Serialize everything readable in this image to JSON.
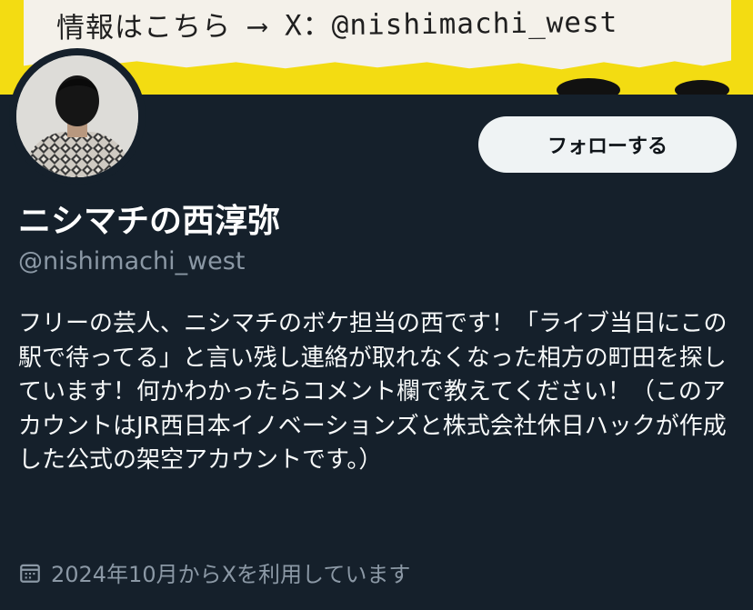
{
  "banner": {
    "text": "情報はこちら ⟶ X：@nishimachi_west"
  },
  "profile": {
    "follow_label": "フォローする",
    "display_name": "ニシマチの西淳弥",
    "handle": "@nishimachi_west",
    "bio": "フリーの芸人、ニシマチのボケ担当の西です！「ライブ当日にこの駅で待ってる」と言い残し連絡が取れなくなった相方の町田を探しています！何かわかったらコメント欄で教えてください！（このアカウントはJR西日本イノベーションズと株式会社休日ハックが作成した公式の架空アカウントです。）",
    "joined": "2024年10月からXを利用しています"
  },
  "icons": {
    "calendar": "calendar-icon"
  },
  "colors": {
    "background": "#15202b",
    "banner_yellow": "#f3dc12",
    "follow_bg": "#eff3f4",
    "muted_text": "#8b98a5"
  }
}
